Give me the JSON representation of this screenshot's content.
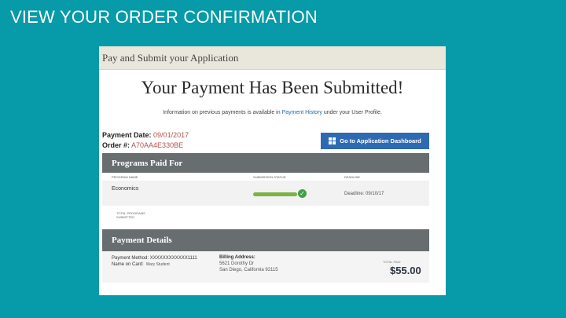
{
  "slide": {
    "title": "VIEW YOUR ORDER CONFIRMATION"
  },
  "app": {
    "header_title": "Pay and Submit your Application",
    "headline": "Your Payment Has Been Submitted!",
    "info": {
      "prefix": "Information on previous payments is available in",
      "link": "Payment History",
      "suffix": "under your User Profile."
    },
    "payment_date": {
      "label": "Payment Date:",
      "value": "09/01/2017"
    },
    "order_number": {
      "label": "Order #:",
      "value": "A70AA4E330BE"
    },
    "dashboard_button": "Go to Application Dashboard",
    "programs": {
      "title": "Programs Paid For",
      "columns": [
        "PROGRAM NAME",
        "SUBMISSION STATUS",
        "DEADLINE"
      ],
      "rows": [
        {
          "name": "Economics",
          "deadline": "Deadline: 09/10/17"
        }
      ],
      "total_label": "TOTAL PROGRAMS SUBMITTED"
    },
    "payment_details": {
      "title": "Payment Details",
      "method_label": "Payment Method:",
      "method_value": "XXXXXXXXXXXX1111",
      "name_label": "Name on Card:",
      "name_value": "Mary Student",
      "billing_label": "Billing Address:",
      "billing_line1": "5621 Dorothy Dr",
      "billing_line2": "San Diego, California 92115",
      "total_label": "TOTAL PAID",
      "total_value": "$55.00"
    }
  },
  "colors": {
    "background": "#079aa8",
    "section_bar": "#686e70",
    "button": "#2e6ab4",
    "status": "#7cb342"
  }
}
